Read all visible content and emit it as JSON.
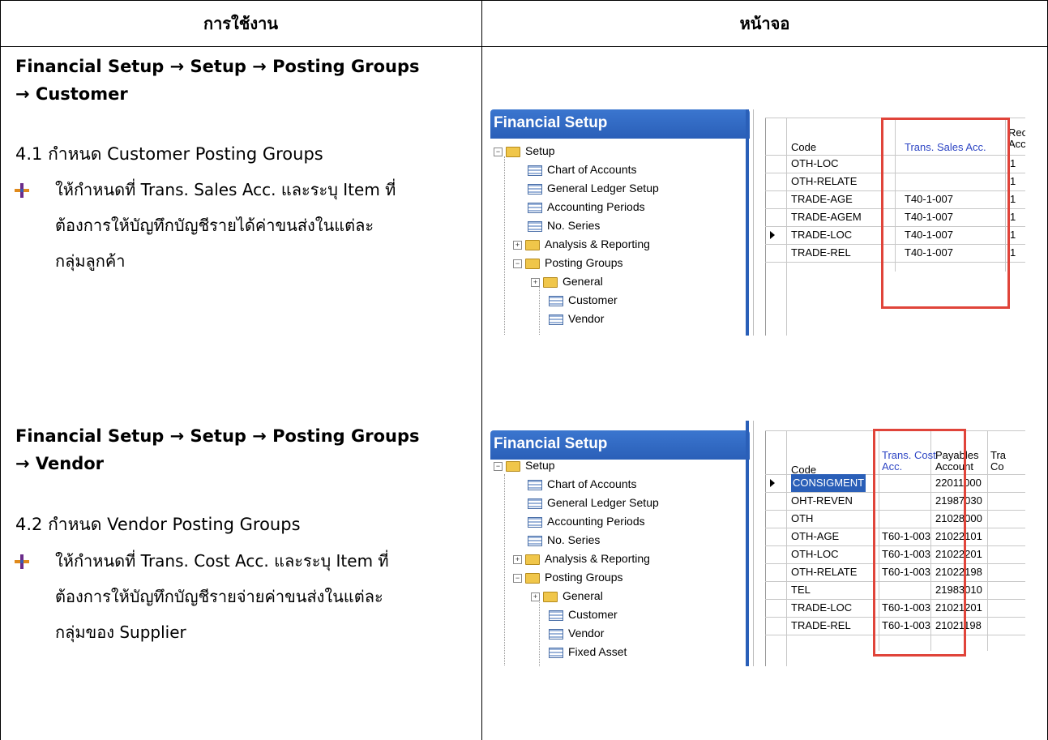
{
  "table": {
    "col_usage": "การใช้งาน",
    "col_screen": "หน้าจอ"
  },
  "section1": {
    "heading_line1": "Financial Setup → Setup → Posting Groups",
    "heading_line2": "→ Customer",
    "step": "4.1 กำหนด Customer Posting Groups",
    "bullet_line1": "ให้กำหนดที่  Trans. Sales Acc. และระบุ Item ที่",
    "bullet_line2": "ต้องการให้บัญทึกบัญชีรายได้ค่าขนส่งในแต่ละ",
    "bullet_line3": "กลุ่มลูกค้า"
  },
  "section2": {
    "heading_line1": "Financial Setup → Setup → Posting Groups",
    "heading_line2": "→ Vendor",
    "step": "4.2 กำหนด Vendor Posting Groups",
    "bullet_line1": "ให้กำหนดที่  Trans. Cost Acc. และระบุ Item ที่",
    "bullet_line2": "ต้องการให้บัญทึกบัญชีรายจ่ายค่าขนส่งในแต่ละ",
    "bullet_line3": "กลุ่มของ Supplier"
  },
  "shot1": {
    "nav_title": "Financial Setup",
    "tree": [
      "Setup",
      "Chart of Accounts",
      "General Ledger Setup",
      "Accounting Periods",
      "No. Series",
      "Analysis & Reporting",
      "Posting Groups",
      "General",
      "Customer",
      "Vendor"
    ],
    "col_code": "Code",
    "col_trans": "Trans. Sales Acc.",
    "col_next_top": "Rec",
    "col_next_bottom": "Acc",
    "rows": [
      {
        "code": "OTH-LOC",
        "trans": "",
        "next": "1"
      },
      {
        "code": "OTH-RELATE",
        "trans": "",
        "next": "1"
      },
      {
        "code": "TRADE-AGE",
        "trans": "T40-1-007",
        "next": "1"
      },
      {
        "code": "TRADE-AGEM",
        "trans": "T40-1-007",
        "next": "1"
      },
      {
        "code": "TRADE-LOC",
        "trans": "T40-1-007",
        "next": "1"
      },
      {
        "code": "TRADE-REL",
        "trans": "T40-1-007",
        "next": "1"
      }
    ]
  },
  "shot2": {
    "nav_title": "Financial Setup",
    "tree": [
      "Setup",
      "Chart of Accounts",
      "General Ledger Setup",
      "Accounting Periods",
      "No. Series",
      "Analysis & Reporting",
      "Posting Groups",
      "General",
      "Customer",
      "Vendor",
      "Fixed Asset"
    ],
    "col_code": "Code",
    "col_trans_1": "Trans. Cost",
    "col_trans_2": "Acc.",
    "col_pay_1": "Payables",
    "col_pay_2": "Account",
    "col_next_1": "Tra",
    "col_next_2": "Co",
    "rows": [
      {
        "code": "CONSIGMENT",
        "trans": "",
        "pay": "22011000"
      },
      {
        "code": "OHT-REVEN",
        "trans": "",
        "pay": "21987030"
      },
      {
        "code": "OTH",
        "trans": "",
        "pay": "21028000"
      },
      {
        "code": "OTH-AGE",
        "trans": "T60-1-003",
        "pay": "21022101"
      },
      {
        "code": "OTH-LOC",
        "trans": "T60-1-003",
        "pay": "21022201"
      },
      {
        "code": "OTH-RELATE",
        "trans": "T60-1-003",
        "pay": "21022198"
      },
      {
        "code": "TEL",
        "trans": "",
        "pay": "21983010"
      },
      {
        "code": "TRADE-LOC",
        "trans": "T60-1-003",
        "pay": "21021201"
      },
      {
        "code": "TRADE-REL",
        "trans": "T60-1-003",
        "pay": "21021198"
      }
    ]
  },
  "colors": {
    "highlight": "#e0443a",
    "nav_title": "#2a5fb8"
  }
}
